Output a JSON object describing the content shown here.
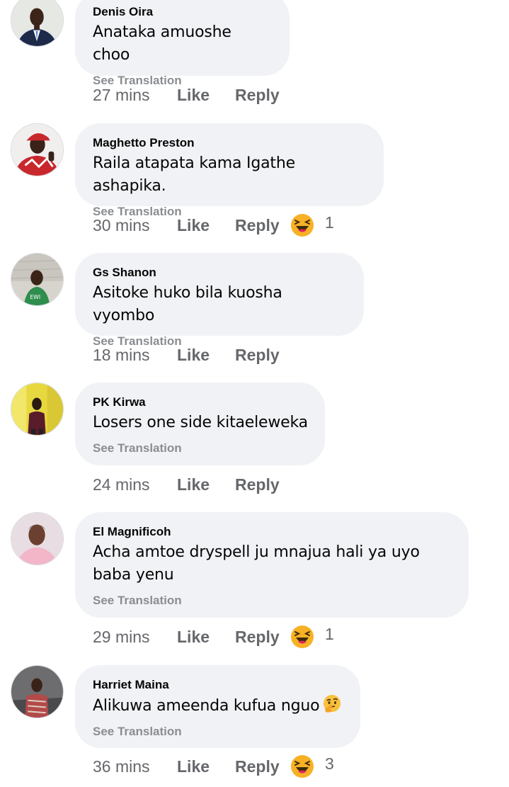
{
  "comments": [
    {
      "author": "Denis Oira",
      "text": "Anataka amuoshe choo",
      "translate_label": "See Translation",
      "time": "27 mins",
      "like_label": "Like",
      "reply_label": "Reply"
    },
    {
      "author": "Maghetto Preston",
      "text": "Raila atapata kama Igathe ashapika.",
      "translate_label": "See Translation",
      "time": "30 mins",
      "like_label": "Like",
      "reply_label": "Reply",
      "reaction_icon": "laughing-emoji-icon",
      "reaction_count": "1"
    },
    {
      "author": "Gs Shanon",
      "text": "Asitoke huko bila kuosha vyombo",
      "translate_label": "See Translation",
      "time": "18 mins",
      "like_label": "Like",
      "reply_label": "Reply"
    },
    {
      "author": "PK Kirwa",
      "text": "Losers one side kitaeleweka",
      "translate_label": "See Translation",
      "time": "24 mins",
      "like_label": "Like",
      "reply_label": "Reply"
    },
    {
      "author": "El Magnificoh",
      "text": "Acha amtoe dryspell ju mnajua hali ya uyo baba yenu",
      "translate_label": "See Translation",
      "time": "29 mins",
      "like_label": "Like",
      "reply_label": "Reply",
      "reaction_icon": "laughing-emoji-icon",
      "reaction_count": "1"
    },
    {
      "author": "Harriet Maina",
      "text": "Alikuwa ameenda kufua nguo",
      "text_emoji": "thinking-emoji-icon",
      "translate_label": "See Translation",
      "time": "36 mins",
      "like_label": "Like",
      "reply_label": "Reply",
      "reaction_icon": "laughing-emoji-icon",
      "reaction_count": "3"
    }
  ],
  "colors": {
    "bubble": "#f0f2f5",
    "name": "#050505",
    "meta": "#65676b",
    "translate": "#8a8d91",
    "reaction_yellow": "#f7b125",
    "reaction_mouth": "#e0245e"
  }
}
